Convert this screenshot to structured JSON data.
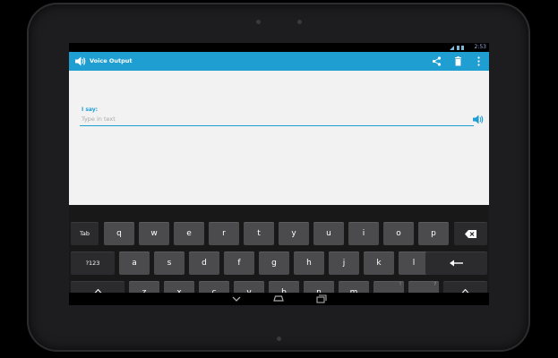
{
  "status": {
    "time": "2:53"
  },
  "app": {
    "title": "Voice Output"
  },
  "content": {
    "label": "I say:",
    "input_value": "",
    "input_placeholder": "Type in text"
  },
  "keyboard": {
    "row1": {
      "tab": "Tab",
      "keys": [
        "q",
        "w",
        "e",
        "r",
        "t",
        "y",
        "u",
        "i",
        "o",
        "p"
      ]
    },
    "row2": {
      "sym": "?123",
      "keys": [
        "a",
        "s",
        "d",
        "f",
        "g",
        "h",
        "j",
        "k",
        "l"
      ]
    },
    "row3": {
      "keys": [
        "z",
        "x",
        "c",
        "v",
        "b",
        "n",
        "m",
        ",",
        "."
      ],
      "hint_comma": "!",
      "hint_period": "?"
    },
    "row4": {
      "slash": "/",
      "slash_hint": "@",
      "apostrophe": "'",
      "apostrophe_hint": "\"",
      "dash": "-",
      "dash_hint": "_",
      "smiley": ":-)"
    }
  },
  "colors": {
    "accent": "#1f9ed1",
    "key": "#4b4b4e",
    "key_dark": "#2b2b2d",
    "keyboard_bg": "#181819"
  },
  "icons": {
    "app": "speaker-icon",
    "share": "share-icon",
    "delete": "trash-icon",
    "overflow": "overflow-menu-icon",
    "speak": "speaker-icon"
  }
}
